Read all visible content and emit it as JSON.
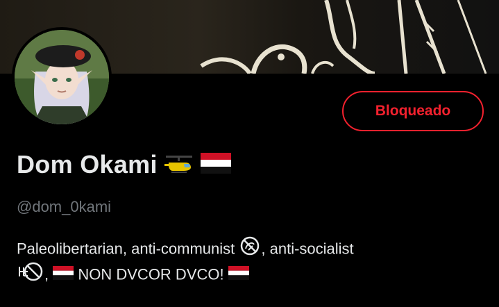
{
  "profile": {
    "display_name": "Dom Okami",
    "name_emojis": [
      "helicopter-icon",
      "yemen-flag-icon"
    ],
    "handle": "@dom_0kami",
    "blocked_button_label": "Bloqueado",
    "bio": {
      "part1": "Paleolibertarian, anti-communist",
      "part2": ", anti-socialist",
      "part3": ",",
      "part4": "NON DVCOR DVCO!"
    }
  },
  "colors": {
    "background": "#000000",
    "text": "#e7e9ea",
    "muted": "#71767b",
    "danger": "#f4212e"
  }
}
